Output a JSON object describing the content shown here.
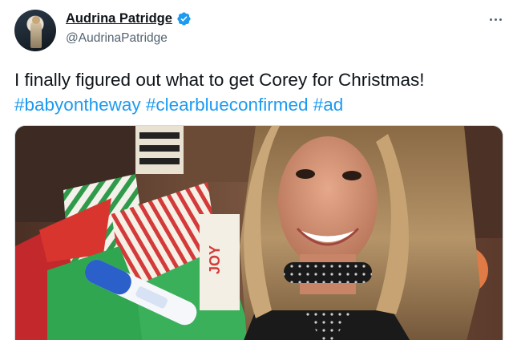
{
  "tweet": {
    "author": {
      "display_name": "Audrina Patridge",
      "handle": "@AudrinaPatridge",
      "verified": true
    },
    "text_line1": "I finally figured out what to get Corey for Christmas!",
    "hashtags": [
      "#babyontheway",
      "#clearblueconfirmed",
      "#ad"
    ],
    "media_icon": "photo"
  },
  "colors": {
    "link": "#1d9bf0",
    "text": "#0f1419",
    "secondary": "#536471",
    "verified_badge": "#1d9bf0"
  },
  "icons": {
    "verified": "verified-badge-icon",
    "more": "more-options-icon"
  }
}
